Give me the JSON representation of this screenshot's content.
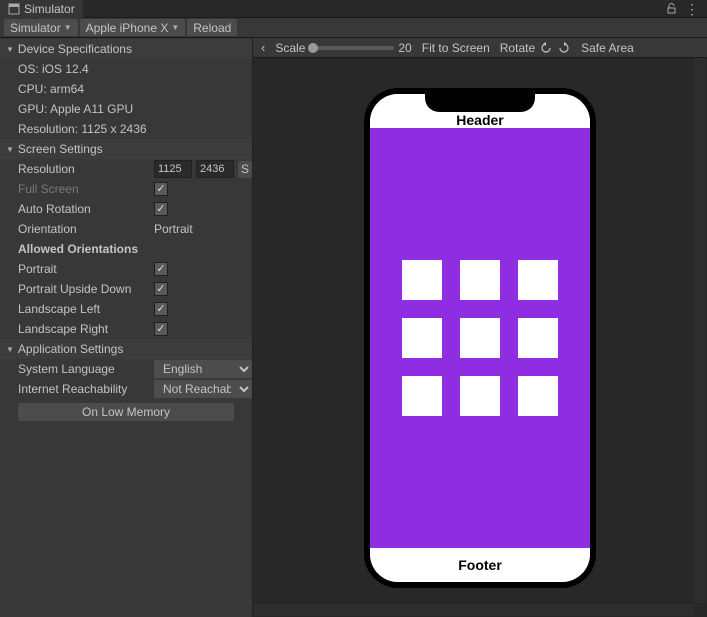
{
  "window": {
    "title": "Simulator"
  },
  "toolbar": {
    "simulator_btn": "Simulator",
    "device_btn": "Apple iPhone X",
    "reload_btn": "Reload"
  },
  "device_spec": {
    "header": "Device Specifications",
    "os": "OS: iOS 12.4",
    "cpu": "CPU: arm64",
    "gpu": "GPU: Apple A11 GPU",
    "res": "Resolution: 1125 x 2436"
  },
  "screen": {
    "header": "Screen Settings",
    "resolution_lbl": "Resolution",
    "res_w": "1125",
    "res_h": "2436",
    "fullscreen_lbl": "Full Screen",
    "autorot_lbl": "Auto Rotation",
    "orientation_lbl": "Orientation",
    "orientation_val": "Portrait",
    "allowed_header": "Allowed Orientations",
    "portrait_lbl": "Portrait",
    "portrait_ud_lbl": "Portrait Upside Down",
    "ls_left_lbl": "Landscape Left",
    "ls_right_lbl": "Landscape Right"
  },
  "app": {
    "header": "Application Settings",
    "sys_lang_lbl": "System Language",
    "sys_lang_val": "English",
    "net_lbl": "Internet Reachability",
    "net_val": "Not Reachable",
    "low_mem_btn": "On Low Memory"
  },
  "preview_bar": {
    "scale_lbl": "Scale",
    "scale_val": "20",
    "fit_btn": "Fit to Screen",
    "rotate_lbl": "Rotate",
    "safe_area_lbl": "Safe Area"
  },
  "phone": {
    "header_txt": "Header",
    "footer_txt": "Footer"
  }
}
